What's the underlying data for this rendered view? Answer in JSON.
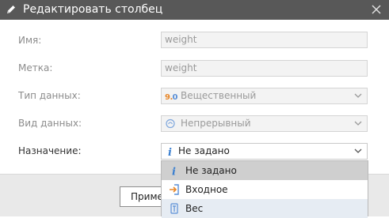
{
  "dialog": {
    "title": "Редактировать столбец",
    "title_icon": "pencil-icon",
    "close_icon": "close-icon"
  },
  "fields": {
    "name": {
      "label": "Имя:",
      "value": "weight"
    },
    "caption": {
      "label": "Метка:",
      "value": "weight"
    },
    "data_type": {
      "label": "Тип данных:",
      "value": "Вещественный",
      "icon": "number-9.0-icon",
      "icon_text": "9.0"
    },
    "data_kind": {
      "label": "Вид данных:",
      "value": "Непрерывный",
      "icon": "continuous-icon"
    },
    "purpose": {
      "label": "Назначение:",
      "value": "Не задано",
      "icon": "info-icon"
    }
  },
  "dropdown": {
    "options": [
      {
        "label": "Не задано",
        "icon": "info-icon",
        "selected": true
      },
      {
        "label": "Входное",
        "icon": "input-arrow-icon"
      },
      {
        "label": "Вес",
        "icon": "weight-icon"
      }
    ]
  },
  "footer": {
    "apply_label": "Приме"
  },
  "colors": {
    "titlebar": "#585858",
    "info_icon": "#3a7fd0",
    "input_icon": "#e8872a",
    "numeric_icon_9": "#e8872a",
    "numeric_icon_0": "#5a8fd6"
  }
}
